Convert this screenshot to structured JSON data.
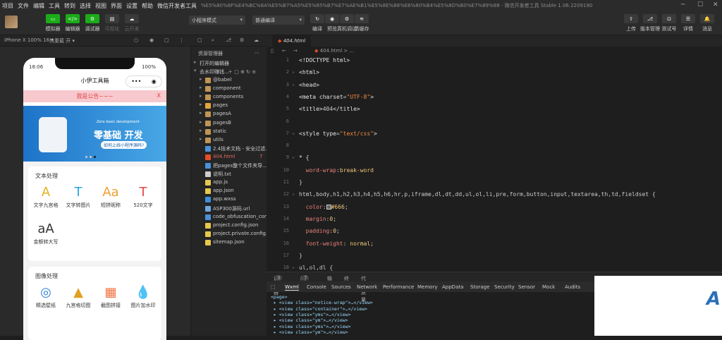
{
  "menu": [
    "项目",
    "文件",
    "编辑",
    "工具",
    "转到",
    "选择",
    "视图",
    "界面",
    "设置",
    "帮助",
    "微信开发者工具"
  ],
  "window_title": "%E5%80%8F%E4%BC%8A%E5%B7%A5%E5%85%B7%E7%AE%B1%E5%8E%88%E6%80%B4%E5%8D%B0%E7%89%88 - 微信开发者工具 Stable 1.06.2209190",
  "window_buttons": [
    "─",
    "☐",
    "✕"
  ],
  "toolbar": {
    "left": [
      {
        "label": "模拟器",
        "icon": "▭",
        "green": true
      },
      {
        "label": "编辑器",
        "icon": "</>",
        "green": true
      },
      {
        "label": "调试器",
        "icon": "⚙",
        "green": true
      },
      {
        "label": "可视化",
        "icon": "▤",
        "green": false
      },
      {
        "label": "云开发",
        "icon": "☁",
        "green": false
      }
    ],
    "mode_select": "小程序模式",
    "compile_select": "普通编译",
    "center": [
      {
        "label": "编译",
        "icon": "↻"
      },
      {
        "label": "预览",
        "icon": "◉"
      },
      {
        "label": "真机调试",
        "icon": "⚙"
      },
      {
        "label": "清缓存",
        "icon": "≋"
      }
    ],
    "right": [
      {
        "label": "上传",
        "icon": "⇧"
      },
      {
        "label": "版本管理",
        "icon": "⎇"
      },
      {
        "label": "测试号",
        "icon": "⊡"
      },
      {
        "label": "详情",
        "icon": "☰"
      },
      {
        "label": "消息",
        "icon": "🔔"
      }
    ]
  },
  "device": "iPhone X 100% 16 ▾",
  "hot_reload": "热重载 开 ▾",
  "phone": {
    "time": "18:06",
    "battery": "100%",
    "title": "小伊工具箱",
    "notice": "我是公告~~~",
    "notice_close": "X",
    "banner_title": "零基础 开发",
    "banner_sub": "Zero basic development",
    "banner_tag": "如何上线小程序源码?",
    "section1_title": "文本处理",
    "section1_items": [
      {
        "label": "文字九宫格",
        "icon": "A",
        "color": "#e8b020"
      },
      {
        "label": "文字转图片",
        "icon": "T",
        "color": "#2aa3e0"
      },
      {
        "label": "短拼昵称",
        "icon": "Aa",
        "color": "#f0a030"
      },
      {
        "label": "520文字",
        "icon": "T",
        "color": "#e04848"
      },
      {
        "label": "金额转大写",
        "icon": "aA",
        "color": "#333333"
      }
    ],
    "section2_title": "图像处理",
    "section2_items": [
      {
        "label": "精选壁纸",
        "icon": "◎",
        "color": "#2b7fd6"
      },
      {
        "label": "九宫格切图",
        "icon": "▲",
        "color": "#e0a020"
      },
      {
        "label": "截图拼接",
        "icon": "▦",
        "color": "#f07040"
      },
      {
        "label": "图片加水印",
        "icon": "💧",
        "color": "#3aa0e8"
      }
    ]
  },
  "explorer": {
    "title": "资源管理器",
    "open_editors": "打开的编辑器",
    "project": "去水印赚钱...",
    "items": [
      {
        "name": "@babel",
        "type": "folder"
      },
      {
        "name": "component",
        "type": "folder"
      },
      {
        "name": "components",
        "type": "folder"
      },
      {
        "name": "pages",
        "type": "folder-orange"
      },
      {
        "name": "pagesA",
        "type": "folder"
      },
      {
        "name": "pagesB",
        "type": "folder"
      },
      {
        "name": "static",
        "type": "folder"
      },
      {
        "name": "utils",
        "type": "folder"
      },
      {
        "name": "2.4技术文档 - 安全过滤...",
        "type": "doc"
      },
      {
        "name": "404.html",
        "type": "html",
        "badge": "7"
      },
      {
        "name": "把pages整个文件夹导...",
        "type": "doc"
      },
      {
        "name": "说明.txt",
        "type": "txt"
      },
      {
        "name": "app.js",
        "type": "js"
      },
      {
        "name": "app.json",
        "type": "json"
      },
      {
        "name": "app.wxss",
        "type": "wxss"
      },
      {
        "name": "ASP300源码.url",
        "type": "url"
      },
      {
        "name": "code_obfuscation_conf...",
        "type": "doc"
      },
      {
        "name": "project.config.json",
        "type": "json"
      },
      {
        "name": "project.private.config.js...",
        "type": "json"
      },
      {
        "name": "sitemap.json",
        "type": "json"
      }
    ]
  },
  "editor": {
    "tab": "404.html",
    "crumb": "404.html > ...",
    "lines": [
      {
        "n": "1",
        "html": "<span class=\"tg\">&lt;!DOCTYPE html&gt;</span>"
      },
      {
        "n": "2",
        "html": "<span class=\"tg\">&lt;html&gt;</span>"
      },
      {
        "n": "3",
        "html": "<span class=\"tg\">&lt;head&gt;</span>"
      },
      {
        "n": "4",
        "html": "<span class=\"tg\">&lt;meta</span> <span class=\"at\">charset</span>=<span class=\"st\">\"UTF-8\"</span><span class=\"tg\">&gt;</span>"
      },
      {
        "n": "5",
        "html": "<span class=\"tg\">&lt;title&gt;</span>404<span class=\"tg\">&lt;/title&gt;</span>"
      },
      {
        "n": "6",
        "html": ""
      },
      {
        "n": "7",
        "html": "<span class=\"tg\">&lt;style</span> <span class=\"at\">type</span>=<span class=\"st\">\"text/css\"</span><span class=\"tg\">&gt;</span>"
      },
      {
        "n": "8",
        "html": ""
      },
      {
        "n": "9",
        "html": "<span class=\"tg\">* {</span>"
      },
      {
        "n": "10",
        "html": "  <span class=\"pr\">word-wrap</span>:<span class=\"vl\">break-word</span>"
      },
      {
        "n": "11",
        "html": "}"
      },
      {
        "n": "12",
        "html": "html,body,h1,h2,h3,h4,h5,h6,hr,p,iframe,dl,dt,dd,ul,ol,li,pre,form,button,input,textarea,th,td,fieldset {"
      },
      {
        "n": "13",
        "html": "  <span class=\"pr\">color</span>:<span class=\"sw\"></span><span class=\"vl\">#666</span>;"
      },
      {
        "n": "14",
        "html": "  <span class=\"pr\">margin</span>:<span class=\"vl\">0</span>;"
      },
      {
        "n": "15",
        "html": "  <span class=\"pr\">padding</span>:<span class=\"vl\">0</span>;"
      },
      {
        "n": "16",
        "html": "  <span class=\"pr\">font-weight</span>: <span class=\"vl\">normal</span>;"
      },
      {
        "n": "17",
        "html": "}"
      },
      {
        "n": "18",
        "html": "ul,ol,dl {"
      }
    ]
  },
  "devtools": {
    "tabs1": [
      {
        "label": "调试器",
        "badge": "3"
      },
      {
        "label": "问题",
        "badge": "7"
      },
      {
        "label": "输出"
      },
      {
        "label": "终端"
      },
      {
        "label": "代码质量"
      }
    ],
    "tabs2": [
      "Wxml",
      "Console",
      "Sources",
      "Network",
      "Performance",
      "Memory",
      "AppData",
      "Storage",
      "Security",
      "Sensor",
      "Mock",
      "Audits"
    ],
    "xml_lines": [
      "<page>",
      " ▸ <view class=\"notice-wrap\">…</view>",
      " ▸ <view class=\"container\">…</view>",
      " ▸ <view class=\"yms\">…</view>",
      " ▸ <view class=\"ym\">…</view>",
      " ▸ <view class=\"yms\">…</view>",
      " ▸ <view class=\"ym\">…</view>"
    ]
  },
  "watermark_logo": "A"
}
